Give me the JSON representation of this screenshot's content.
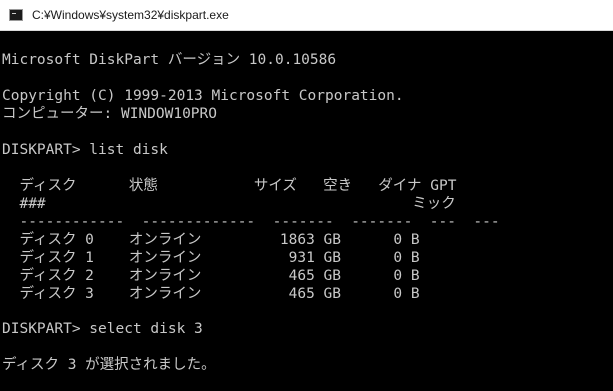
{
  "window": {
    "title": "C:¥Windows¥system32¥diskpart.exe"
  },
  "console": {
    "lines": [
      "Microsoft DiskPart バージョン 10.0.10586",
      "Copyright (C) 1999-2013 Microsoft Corporation.",
      "コンピューター: WINDOW10PRO",
      "DISKPART> list disk",
      "  ディスク      状態           サイズ   空き   ダイナ GPT",
      "  ###                                          ミック",
      "  ------------  -------------  -------  -------  ---  ---",
      "  ディスク 0    オンライン         1863 GB      0 B",
      "  ディスク 1    オンライン          931 GB      0 B",
      "  ディスク 2    オンライン          465 GB      0 B",
      "  ディスク 3    オンライン          465 GB      0 B",
      "DISKPART> select disk 3",
      "ディスク 3 が選択されました。"
    ]
  }
}
